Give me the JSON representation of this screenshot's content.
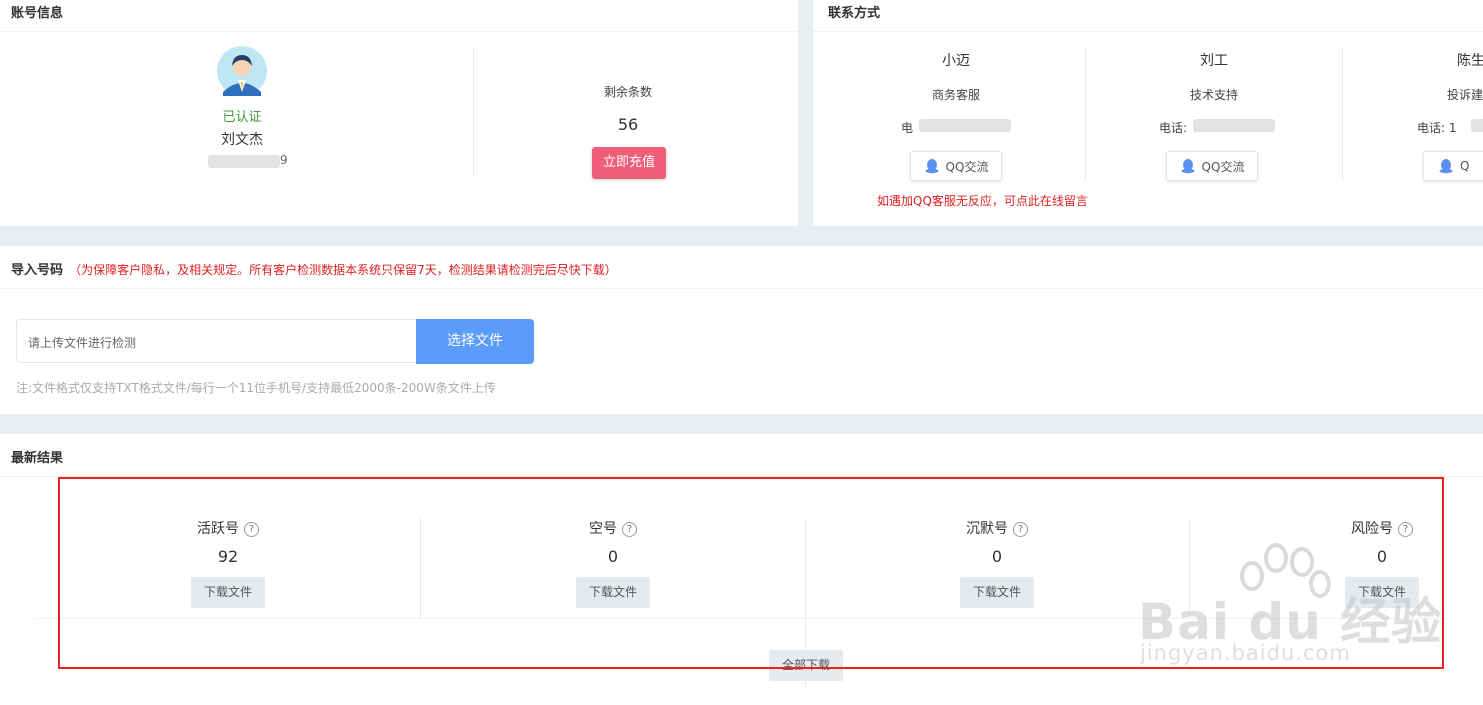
{
  "account": {
    "title": "账号信息",
    "verified": "已认证",
    "name": "刘文杰",
    "phone_suffix": "9",
    "remaining_label": "剩余条数",
    "remaining_value": "56",
    "recharge_label": "立即充值"
  },
  "contact": {
    "title": "联系方式",
    "people": [
      {
        "name": "小迈",
        "role": "商务客服",
        "phone_prefix": "电"
      },
      {
        "name": "刘工",
        "role": "技术支持",
        "phone_prefix": "电话: "
      },
      {
        "name": "陈生",
        "role": "投诉建",
        "phone_prefix": "电话: 1"
      }
    ],
    "qq_label": "QQ交流",
    "qq_label_partial": "Q",
    "notice": "如遇加QQ客服无反应，可点此在线留言"
  },
  "import": {
    "title": "导入号码",
    "notice": "（为保障客户隐私，及相关规定。所有客户检测数据本系统只保留7天，检测结果请检测完后尽快下载）",
    "placeholder": "请上传文件进行检测",
    "choose_label": "选择文件",
    "note": "注:文件格式仅支持TXT格式文件/每行一个11位手机号/支持最低2000条-200W条文件上传"
  },
  "results": {
    "title": "最新结果",
    "items": [
      {
        "label": "活跃号",
        "value": "92"
      },
      {
        "label": "空号",
        "value": "0"
      },
      {
        "label": "沉默号",
        "value": "0"
      },
      {
        "label": "风险号",
        "value": "0"
      }
    ],
    "download_label": "下载文件",
    "download_all_label": "全部下载",
    "help_glyph": "?"
  },
  "watermark": {
    "brand_text": "Bai du 经验",
    "url": "jingyan.baidu.com"
  },
  "colors": {
    "accent_blue": "#5b9bf9",
    "recharge_pink": "#f05f7a",
    "alert_red": "#e02020",
    "verified_green": "#3a9a3a",
    "highlight_box": "#e8231e"
  }
}
